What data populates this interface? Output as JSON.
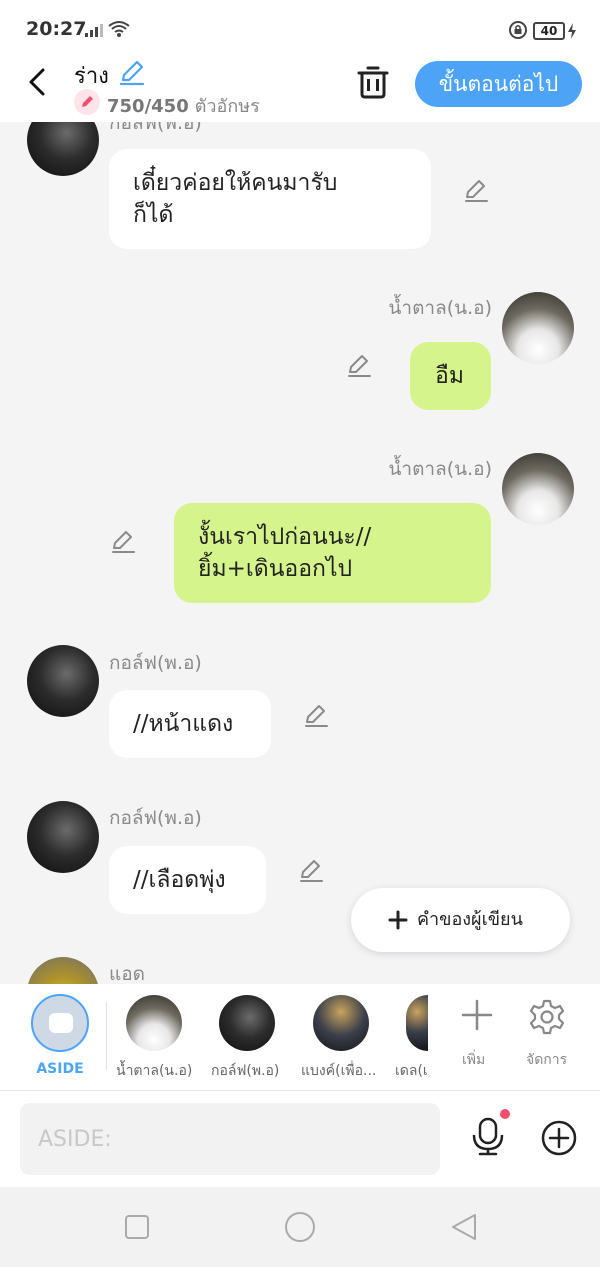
{
  "status_bar": {
    "time": "20:27",
    "battery": "40"
  },
  "header": {
    "title": "ร่าง",
    "char_count": "750/450",
    "char_unit": "ตัวอักษร",
    "next_label": "ขั้นตอนต่อไป"
  },
  "messages": [
    {
      "sender": "กอล์ฟ(พ.อ)",
      "text_lines": [
        "เดี๋ยวค่อยให้คนมารับ",
        "ก็ได้"
      ],
      "side": "left",
      "bubble": "white"
    },
    {
      "sender": "น้ำตาล(น.อ)",
      "text_lines": [
        "อืม"
      ],
      "side": "right",
      "bubble": "green"
    },
    {
      "sender": "น้ำตาล(น.อ)",
      "text_lines": [
        "งั้นเราไปก่อนนะ//",
        "ยิ้ม+เดินออกไป"
      ],
      "side": "right",
      "bubble": "green"
    },
    {
      "sender": "กอล์ฟ(พ.อ)",
      "text_lines": [
        "//หน้าแดง"
      ],
      "side": "left",
      "bubble": "white"
    },
    {
      "sender": "กอล์ฟ(พ.อ)",
      "text_lines": [
        "//เลือดพุ่ง"
      ],
      "side": "left",
      "bubble": "white"
    },
    {
      "sender": "แอด",
      "text_lines": [],
      "side": "left",
      "bubble": "white"
    }
  ],
  "narration_button": {
    "label": "คำของผู้เขียน"
  },
  "character_bar": {
    "aside_label": "ASIDE",
    "characters": [
      {
        "label": "น้ำตาล(น.อ)"
      },
      {
        "label": "กอล์ฟ(พ.อ)"
      },
      {
        "label": "แบงค์(เพื่อ..."
      },
      {
        "label": "เดล(เ"
      }
    ],
    "add_label": "เพิ่ม",
    "manage_label": "จัดการ"
  },
  "composer": {
    "placeholder": "ASIDE:",
    "value": ""
  },
  "colors": {
    "accent": "#4da3f5",
    "green_bubble": "#d6f48c",
    "white_bubble": "#ffffff",
    "background": "#f4f4f5",
    "notification_dot": "#f0506e"
  },
  "icons": [
    "back-icon",
    "pencil-icon",
    "trash-icon",
    "plus-icon",
    "gear-icon",
    "mic-icon",
    "add-circle-icon",
    "signal-icon",
    "wifi-icon",
    "battery-icon"
  ]
}
